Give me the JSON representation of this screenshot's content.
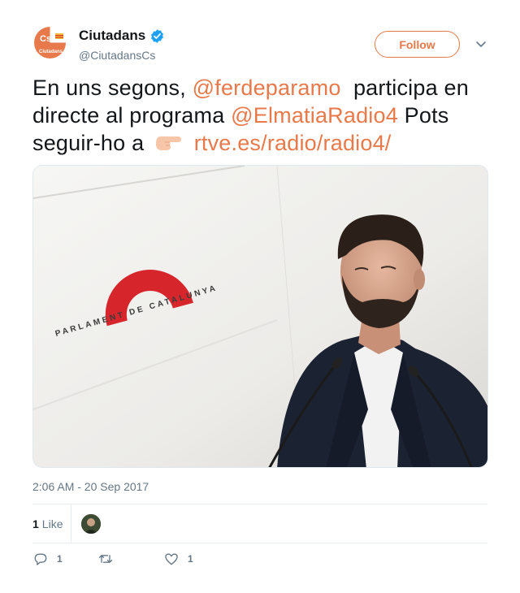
{
  "author": {
    "display_name": "Ciutadans",
    "handle": "@CiutadansCs",
    "avatar_text_top": "Cs",
    "avatar_text_bottom": "Ciutadans",
    "brand_color": "#e8794a"
  },
  "follow_label": "Follow",
  "tweet": {
    "line1_text": "En uns segons,",
    "mention1": "@ferdeparamo",
    "line1_rest": "participa en",
    "line2_text": "directe al programa",
    "mention2": "@ElmatiaRadio4",
    "line2_rest": "Pots",
    "line3_text": "seguir-ho a",
    "emoji": "backhand-index-pointing-right",
    "url": "rtve.es/radio/radio4/"
  },
  "media": {
    "backdrop_text": "PARLAMENT DE CATALUNYA"
  },
  "timestamp": "2:06 AM - 20 Sep 2017",
  "stats": {
    "like_count": "1",
    "like_label": "Like"
  },
  "actions": {
    "reply_count": "1",
    "retweet_count": "",
    "like_count": "1"
  },
  "colors": {
    "link": "#e8794a",
    "secondary_text": "#657786",
    "verified": "#1da1f2"
  }
}
